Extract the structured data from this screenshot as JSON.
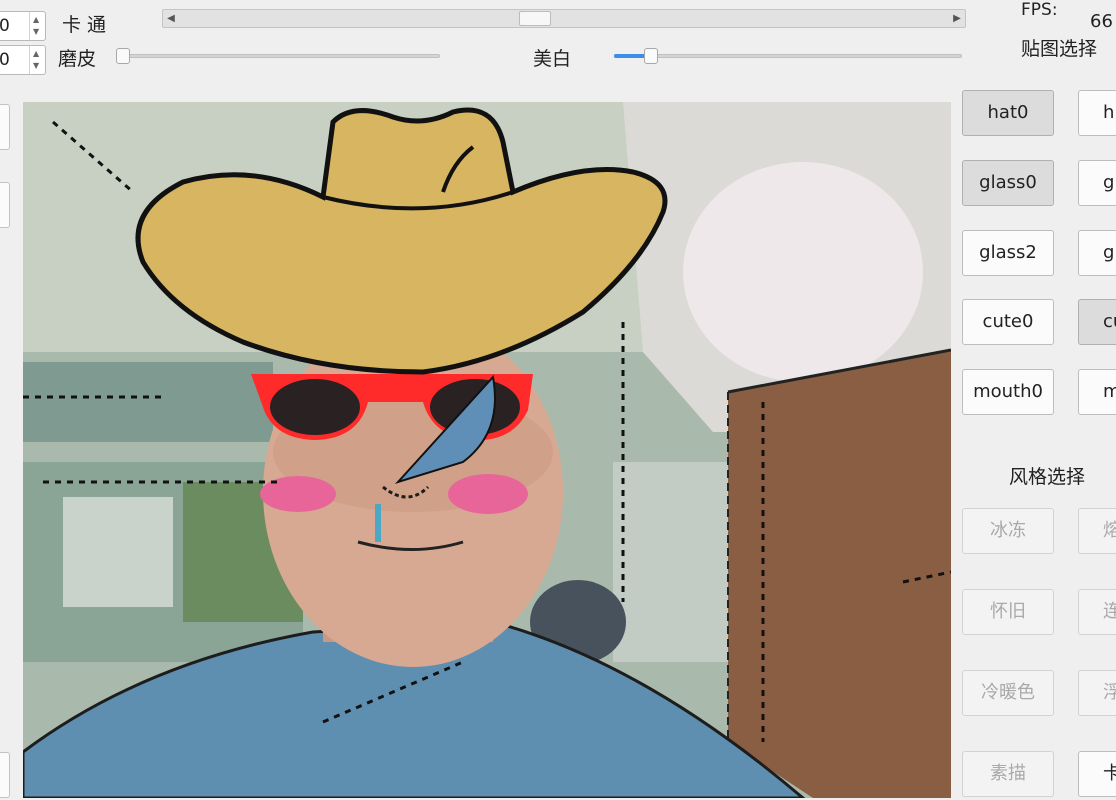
{
  "controls": {
    "spin1_value": "0",
    "spin2_value": "0",
    "cartoon_label": "卡 通",
    "smooth_label": "磨皮",
    "whiten_label": "美白",
    "smooth_level": 0.0,
    "whiten_level": 0.09,
    "scroll_position": 0.46
  },
  "status": {
    "fps_label": "FPS:",
    "fps_value": "66"
  },
  "sticker_panel": {
    "title": "贴图选择",
    "buttons": [
      {
        "label": "hat0",
        "pressed": true
      },
      {
        "label": "h",
        "pressed": false
      },
      {
        "label": "glass0",
        "pressed": true
      },
      {
        "label": "gla",
        "pressed": false
      },
      {
        "label": "glass2",
        "pressed": false
      },
      {
        "label": "gla",
        "pressed": false
      },
      {
        "label": "cute0",
        "pressed": false
      },
      {
        "label": "cu",
        "pressed": true
      },
      {
        "label": "mouth0",
        "pressed": false
      },
      {
        "label": "mo",
        "pressed": false
      }
    ]
  },
  "style_panel": {
    "title": "风格选择",
    "buttons": [
      {
        "label": "冰冻",
        "disabled": true
      },
      {
        "label": "熔",
        "disabled": true
      },
      {
        "label": "怀旧",
        "disabled": true
      },
      {
        "label": "连",
        "disabled": true
      },
      {
        "label": "冷暖色",
        "disabled": true
      },
      {
        "label": "浮",
        "disabled": true
      },
      {
        "label": "素描",
        "disabled": true
      },
      {
        "label": "卡",
        "disabled": false
      }
    ]
  },
  "colors": {
    "accent": "#3a8ee6",
    "hat": "#d8b560",
    "glasses_frame": "#ff3030",
    "shirt": "#5f8fb0"
  }
}
